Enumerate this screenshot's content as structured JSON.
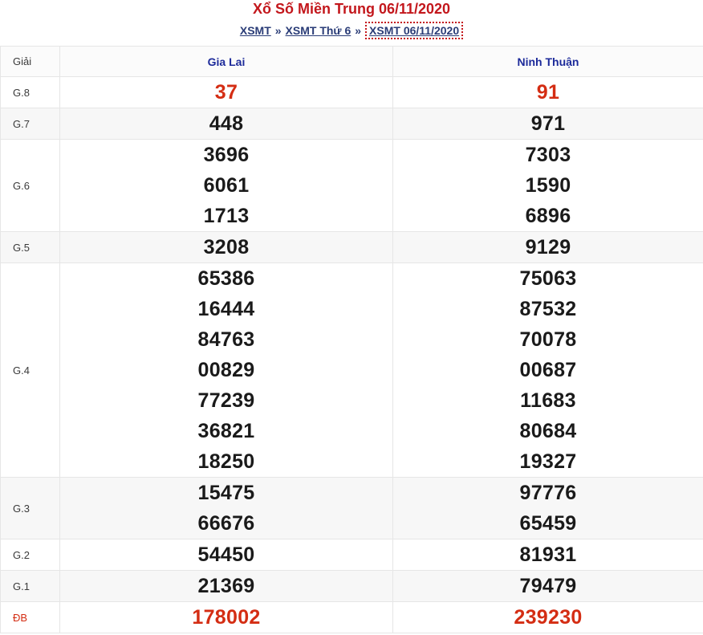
{
  "title": "Xổ Số Miền Trung 06/11/2020",
  "breadcrumb": {
    "items": [
      "XSMT",
      "XSMT Thứ 6",
      "XSMT 06/11/2020"
    ],
    "separator": "»"
  },
  "table": {
    "header_prize": "Giải",
    "provinces": [
      "Gia Lai",
      "Ninh Thuận"
    ],
    "rows": [
      {
        "prize": "G.8",
        "gialai": [
          "37"
        ],
        "ninhthuan": [
          "91"
        ]
      },
      {
        "prize": "G.7",
        "gialai": [
          "448"
        ],
        "ninhthuan": [
          "971"
        ]
      },
      {
        "prize": "G.6",
        "gialai": [
          "3696",
          "6061",
          "1713"
        ],
        "ninhthuan": [
          "7303",
          "1590",
          "6896"
        ]
      },
      {
        "prize": "G.5",
        "gialai": [
          "3208"
        ],
        "ninhthuan": [
          "9129"
        ]
      },
      {
        "prize": "G.4",
        "gialai": [
          "65386",
          "16444",
          "84763",
          "00829",
          "77239",
          "36821",
          "18250"
        ],
        "ninhthuan": [
          "75063",
          "87532",
          "70078",
          "00687",
          "11683",
          "80684",
          "19327"
        ]
      },
      {
        "prize": "G.3",
        "gialai": [
          "15475",
          "66676"
        ],
        "ninhthuan": [
          "97776",
          "65459"
        ]
      },
      {
        "prize": "G.2",
        "gialai": [
          "54450"
        ],
        "ninhthuan": [
          "81931"
        ]
      },
      {
        "prize": "G.1",
        "gialai": [
          "21369"
        ],
        "ninhthuan": [
          "79479"
        ]
      },
      {
        "prize": "ĐB",
        "gialai": [
          "178002"
        ],
        "ninhthuan": [
          "239230"
        ]
      }
    ]
  },
  "colors": {
    "title_red": "#c3171c",
    "link_blue": "#2a3c77",
    "header_blue": "#1c2a9a",
    "highlight_red": "#d42d13"
  }
}
